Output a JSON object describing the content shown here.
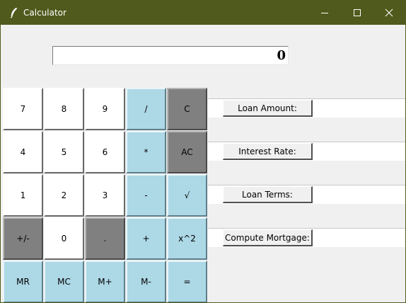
{
  "window": {
    "title": "Calculator",
    "controls": {
      "minimize": "minimize-icon",
      "maximize": "maximize-icon",
      "close": "close-icon"
    },
    "titlebar_color": "#4f5a1c"
  },
  "display": {
    "value": "0"
  },
  "keypad": {
    "rows": [
      [
        {
          "label": "7",
          "style": "white"
        },
        {
          "label": "8",
          "style": "white"
        },
        {
          "label": "9",
          "style": "white"
        },
        {
          "label": "/",
          "style": "blue"
        },
        {
          "label": "C",
          "style": "gray"
        }
      ],
      [
        {
          "label": "4",
          "style": "white"
        },
        {
          "label": "5",
          "style": "white"
        },
        {
          "label": "6",
          "style": "white"
        },
        {
          "label": "*",
          "style": "blue"
        },
        {
          "label": "AC",
          "style": "gray"
        }
      ],
      [
        {
          "label": "1",
          "style": "white"
        },
        {
          "label": "2",
          "style": "white"
        },
        {
          "label": "3",
          "style": "white"
        },
        {
          "label": "-",
          "style": "blue"
        },
        {
          "label": "√",
          "style": "blue"
        }
      ],
      [
        {
          "label": "+/-",
          "style": "gray"
        },
        {
          "label": "0",
          "style": "white"
        },
        {
          "label": ".",
          "style": "gray"
        },
        {
          "label": "+",
          "style": "blue"
        },
        {
          "label": "x^2",
          "style": "blue"
        }
      ],
      [
        {
          "label": "MR",
          "style": "blue"
        },
        {
          "label": "MC",
          "style": "blue"
        },
        {
          "label": "M+",
          "style": "blue"
        },
        {
          "label": "M-",
          "style": "blue"
        },
        {
          "label": "=",
          "style": "blue"
        }
      ]
    ],
    "colors": {
      "white": "#ffffff",
      "blue": "#add8e6",
      "gray": "#808080"
    }
  },
  "mortgage": {
    "buttons": [
      {
        "label": "Loan Amount:",
        "field_value": ""
      },
      {
        "label": "Interest Rate:",
        "field_value": ""
      },
      {
        "label": "Loan Terms:",
        "field_value": ""
      },
      {
        "label": "Compute Mortgage:",
        "field_value": ""
      }
    ]
  }
}
